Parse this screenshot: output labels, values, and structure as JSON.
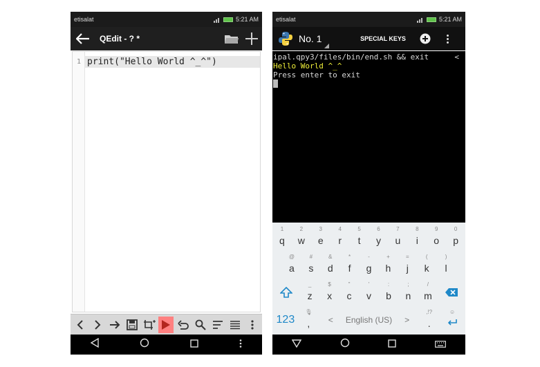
{
  "left": {
    "status": {
      "carrier": "etisalat",
      "time": "5:21 AM"
    },
    "appbar": {
      "title": "QEdit - ? *"
    },
    "editor": {
      "lines": [
        {
          "number": "1",
          "text": "print(\"Hello World ^_^\")"
        }
      ]
    },
    "toolbar": {
      "items": [
        "undo-nav-left",
        "nav-right",
        "redo-arrow",
        "save",
        "crop",
        "run",
        "undo",
        "search",
        "wrap",
        "menu-lines",
        "more"
      ]
    }
  },
  "right": {
    "status": {
      "carrier": "etisalat",
      "time": "5:21 AM"
    },
    "appbar": {
      "tab_label": "No. 1",
      "special_keys": "SPECIAL KEYS"
    },
    "terminal": {
      "line1": "ipal.qpy3/files/bin/end.sh && exit",
      "line1_tail": "<",
      "line2": "Hello World ^_^",
      "line3": "Press enter to exit"
    },
    "keyboard": {
      "row1": [
        {
          "hint": "1",
          "ch": "q"
        },
        {
          "hint": "2",
          "ch": "w"
        },
        {
          "hint": "3",
          "ch": "e"
        },
        {
          "hint": "4",
          "ch": "r"
        },
        {
          "hint": "5",
          "ch": "t"
        },
        {
          "hint": "6",
          "ch": "y"
        },
        {
          "hint": "7",
          "ch": "u"
        },
        {
          "hint": "8",
          "ch": "i"
        },
        {
          "hint": "9",
          "ch": "o"
        },
        {
          "hint": "0",
          "ch": "p"
        }
      ],
      "row2": [
        {
          "hint": "@",
          "ch": "a"
        },
        {
          "hint": "#",
          "ch": "s"
        },
        {
          "hint": "&",
          "ch": "d"
        },
        {
          "hint": "*",
          "ch": "f"
        },
        {
          "hint": "-",
          "ch": "g"
        },
        {
          "hint": "+",
          "ch": "h"
        },
        {
          "hint": "=",
          "ch": "j"
        },
        {
          "hint": "(",
          "ch": "k"
        },
        {
          "hint": ")",
          "ch": "l"
        }
      ],
      "row3": [
        {
          "hint": "_",
          "ch": "z"
        },
        {
          "hint": "$",
          "ch": "x"
        },
        {
          "hint": "\"",
          "ch": "c"
        },
        {
          "hint": "'",
          "ch": "v"
        },
        {
          "hint": ":",
          "ch": "b"
        },
        {
          "hint": ";",
          "ch": "n"
        },
        {
          "hint": "/",
          "ch": "m"
        }
      ],
      "bottom": {
        "numbers_label": "123",
        "comma_hint": "🎙",
        "comma": ",",
        "left_arrow": "<",
        "space_label": "English (US)",
        "right_arrow": ">",
        "period_hint": ",!?",
        "period": ".",
        "emoji_hint": "☺"
      }
    }
  },
  "colors": {
    "run_button": "#ff8080",
    "terminal_output": "#f1f13a",
    "numbers_key": "#1e88c8",
    "delete_key": "#1e88c8"
  }
}
